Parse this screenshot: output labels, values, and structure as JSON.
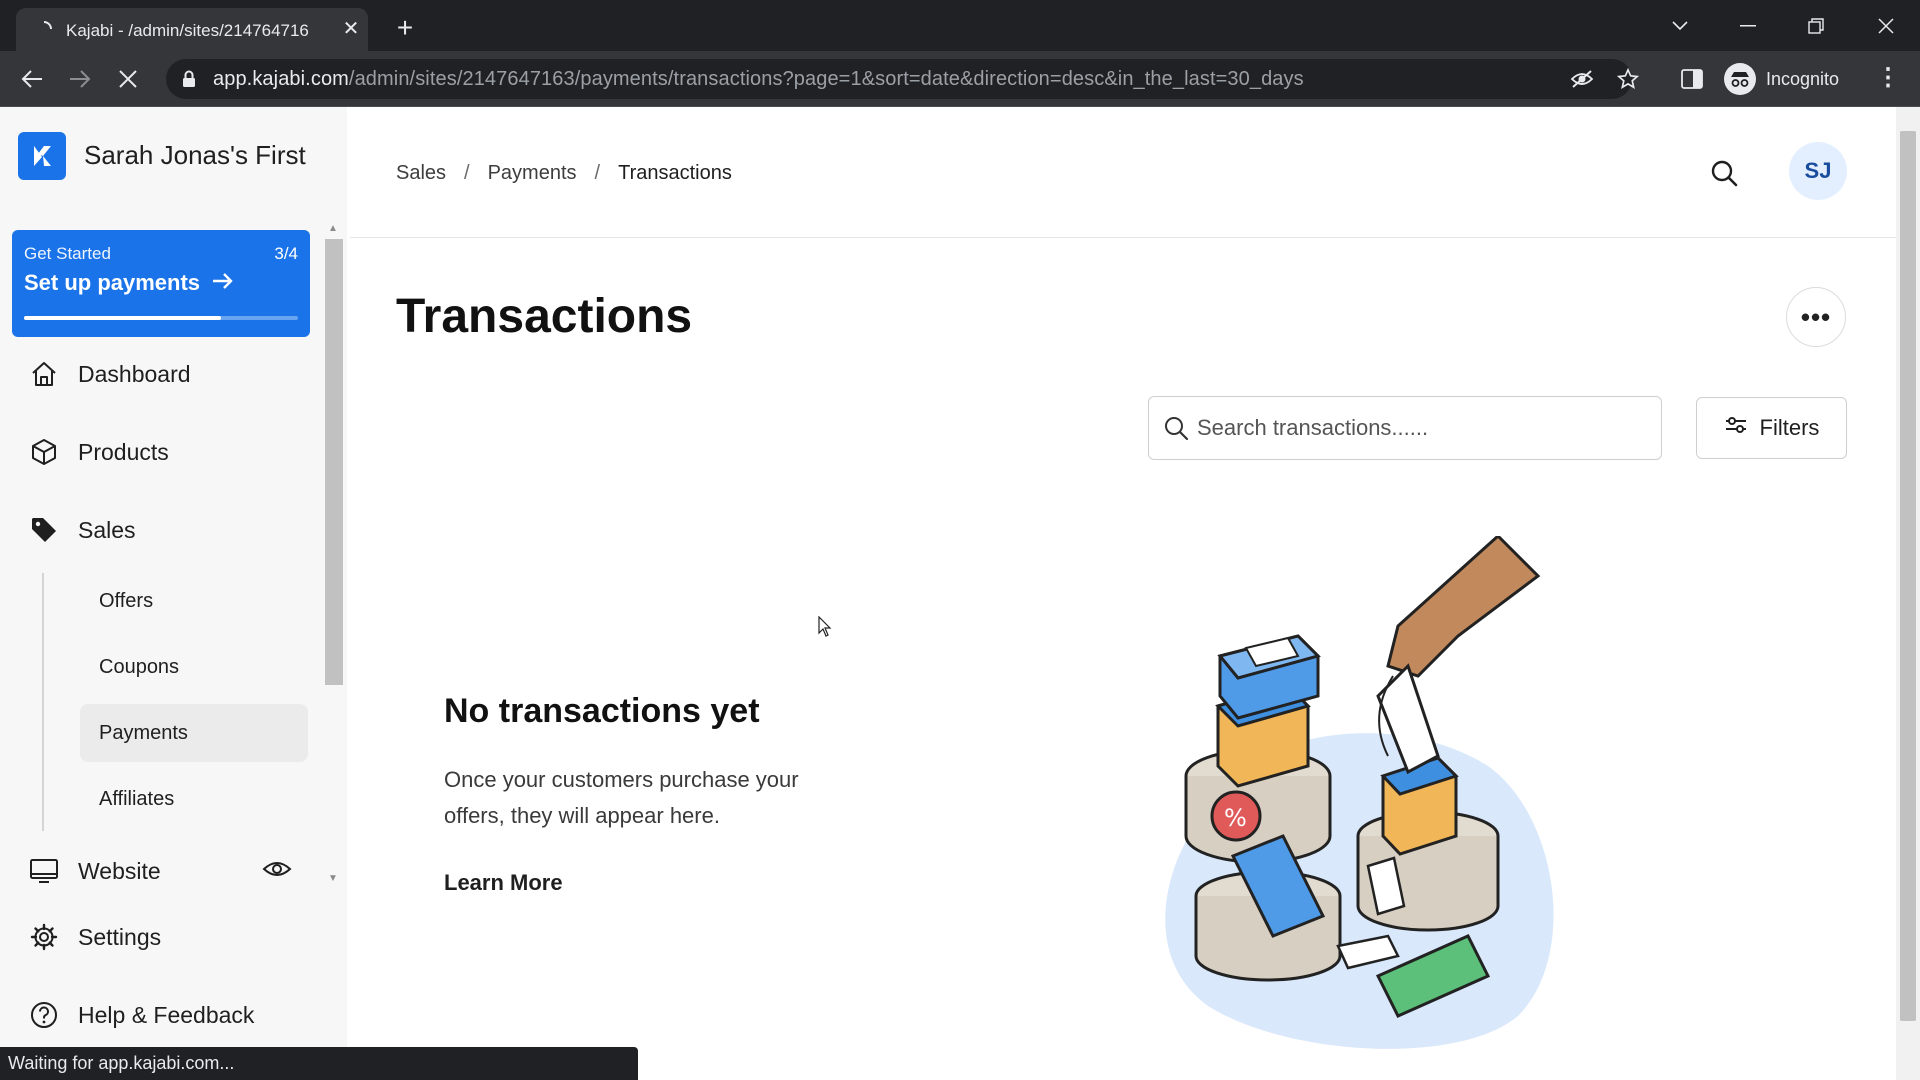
{
  "browser": {
    "tab_title": "Kajabi - /admin/sites/214764716",
    "url_host": "app.kajabi.com",
    "url_path": "/admin/sites/2147647163/payments/transactions?page=1&sort=date&direction=desc&in_the_last=30_days",
    "profile_label": "Incognito",
    "status_text": "Waiting for app.kajabi.com..."
  },
  "sidebar": {
    "brand_name": "Sarah Jonas's First",
    "get_started": {
      "label": "Get Started",
      "count": "3/4",
      "title": "Set up payments",
      "progress": 0.72
    },
    "items": {
      "dashboard": "Dashboard",
      "products": "Products",
      "sales": "Sales",
      "website": "Website",
      "settings": "Settings",
      "help": "Help & Feedback"
    },
    "sales_sub": {
      "offers": "Offers",
      "coupons": "Coupons",
      "payments": "Payments",
      "affiliates": "Affiliates"
    }
  },
  "header": {
    "breadcrumbs": [
      "Sales",
      "Payments",
      "Transactions"
    ],
    "avatar_initials": "SJ"
  },
  "main": {
    "title": "Transactions",
    "search_placeholder": "Search transactions......",
    "filters_label": "Filters",
    "empty_title": "No transactions yet",
    "empty_desc": "Once your customers purchase your offers, they will appear here.",
    "learn_more": "Learn More"
  },
  "colors": {
    "brand_blue": "#1a73e8",
    "sidebar_bg": "#f7f7f7",
    "chrome_dark": "#202124"
  }
}
